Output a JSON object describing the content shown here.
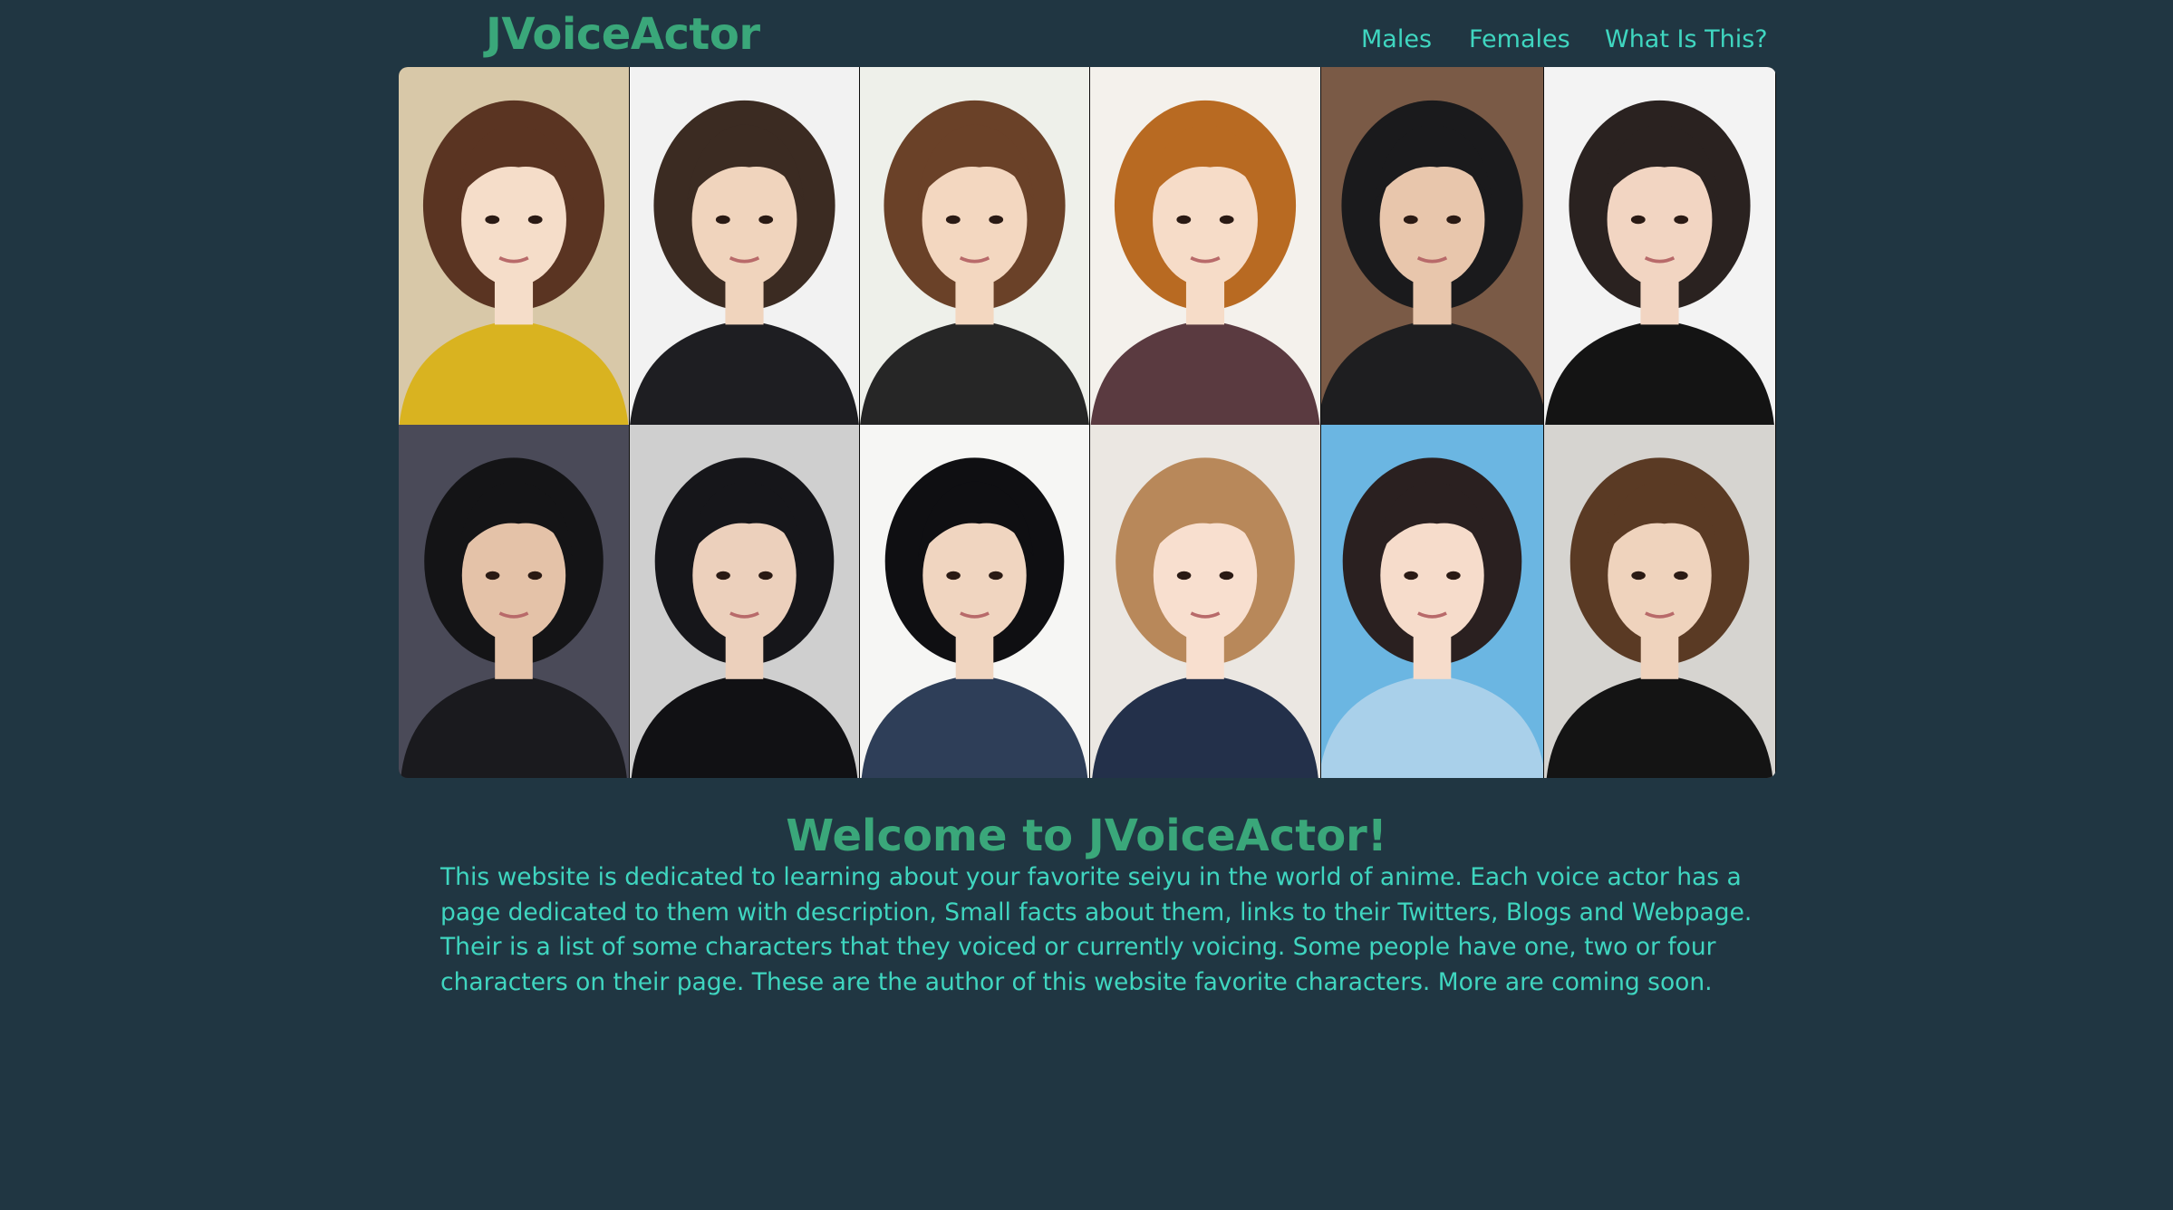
{
  "header": {
    "logo": "JVoiceActor",
    "nav": [
      "Males",
      "Females",
      "What Is This?"
    ]
  },
  "banner": {
    "tiles": [
      {
        "name": "portrait-1",
        "bg": "#d8c8a8",
        "hair": "#5a3422",
        "skin": "#f5ddc9",
        "top": "#d9b320"
      },
      {
        "name": "portrait-2",
        "bg": "#f2f2f2",
        "hair": "#3b2b22",
        "skin": "#f0d4bd",
        "top": "#1e1e22"
      },
      {
        "name": "portrait-3",
        "bg": "#eef0ea",
        "hair": "#6a4128",
        "skin": "#f3d7c0",
        "top": "#262626"
      },
      {
        "name": "portrait-4",
        "bg": "#f4f1ec",
        "hair": "#b86a22",
        "skin": "#f6dcc8",
        "top": "#5a3a40"
      },
      {
        "name": "portrait-5",
        "bg": "#7a5a46",
        "hair": "#1a1a1c",
        "skin": "#e8c6ac",
        "top": "#1e1e20"
      },
      {
        "name": "portrait-6",
        "bg": "#f3f3f3",
        "hair": "#2a2220",
        "skin": "#f2d5c2",
        "top": "#141414"
      },
      {
        "name": "portrait-7",
        "bg": "#4a4a58",
        "hair": "#141416",
        "skin": "#e4c2a8",
        "top": "#1a1a1e"
      },
      {
        "name": "portrait-8",
        "bg": "#cfcfcf",
        "hair": "#16161a",
        "skin": "#ecd0bc",
        "top": "#111114"
      },
      {
        "name": "portrait-9",
        "bg": "#f6f6f4",
        "hair": "#0f0f12",
        "skin": "#f0d5c0",
        "top": "#2e3e58"
      },
      {
        "name": "portrait-10",
        "bg": "#ebe7e2",
        "hair": "#b8885a",
        "skin": "#f8dfcf",
        "top": "#23304a"
      },
      {
        "name": "portrait-11",
        "bg": "#6bb6e2",
        "hair": "#2a2020",
        "skin": "#f6dccb",
        "top": "#a9d0ea"
      },
      {
        "name": "portrait-12",
        "bg": "#d6d4d0",
        "hair": "#5a3a24",
        "skin": "#efd3bd",
        "top": "#141414"
      }
    ]
  },
  "main": {
    "title": "Welcome to JVoiceActor!",
    "body": "This website is dedicated to learning about your favorite seiyu in the world of anime. Each voice actor has a page dedicated to them with description, Small facts about them, links to their Twitters, Blogs and Webpage. Their is a list of some characters that they voiced or currently voicing. Some people have one, two or four characters on their page. These are the author of this website favorite characters. More are coming soon."
  },
  "colors": {
    "background": "#203642",
    "logo": "#3aa77a",
    "nav": "#3fd6c0",
    "heading": "#3aa77a",
    "body_text": "#3fd6c0"
  }
}
